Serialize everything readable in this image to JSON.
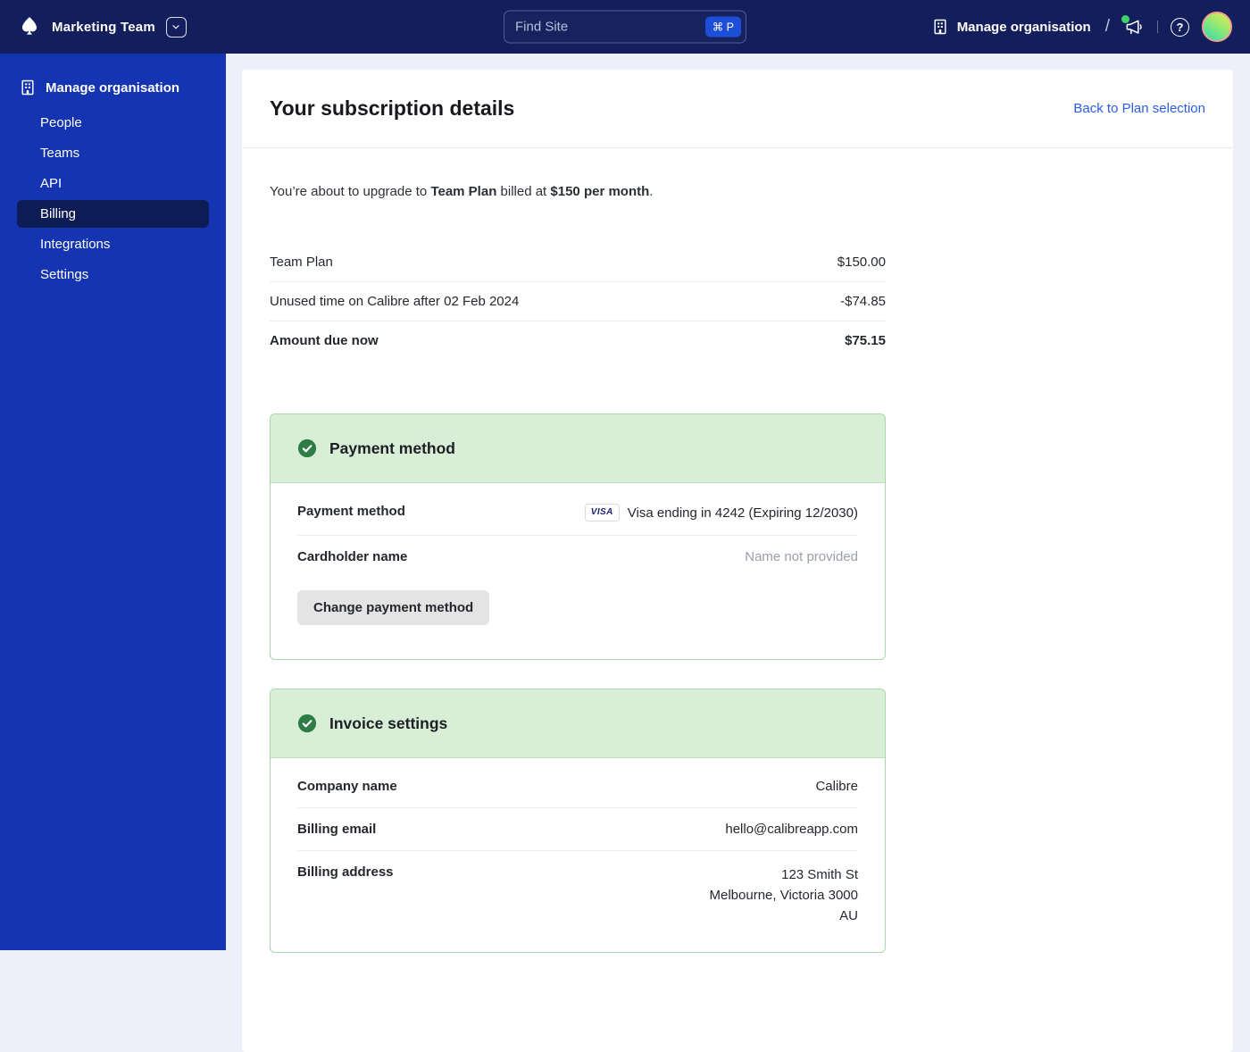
{
  "topbar": {
    "team_name": "Marketing Team",
    "search": {
      "placeholder": "Find Site",
      "shortcut": "⌘ P"
    },
    "manage_org_label": "Manage organisation",
    "slash": "/",
    "help_glyph": "?"
  },
  "sidebar": {
    "header": "Manage organisation",
    "items": [
      {
        "label": "People",
        "active": false
      },
      {
        "label": "Teams",
        "active": false
      },
      {
        "label": "API",
        "active": false
      },
      {
        "label": "Billing",
        "active": true
      },
      {
        "label": "Integrations",
        "active": false
      },
      {
        "label": "Settings",
        "active": false
      }
    ]
  },
  "main": {
    "title": "Your subscription details",
    "back_link": "Back to Plan selection",
    "upgrade_note": {
      "prefix": "You’re about to upgrade to ",
      "plan": "Team Plan",
      "middle": " billed at ",
      "price": "$150 per month",
      "suffix": "."
    },
    "summary_rows": [
      {
        "label": "Team Plan",
        "value": "$150.00"
      },
      {
        "label": "Unused time on Calibre after 02 Feb 2024",
        "value": "-$74.85"
      },
      {
        "label": "Amount due now",
        "value": "$75.15"
      }
    ],
    "payment_card": {
      "title": "Payment method",
      "visa_badge": "VISA",
      "rows": [
        {
          "label": "Payment method",
          "value": "Visa ending in 4242 (Expiring 12/2030)"
        },
        {
          "label": "Cardholder name",
          "value": "Name not provided"
        }
      ],
      "button": "Change payment method"
    },
    "invoice_card": {
      "title": "Invoice settings",
      "rows": [
        {
          "label": "Company name",
          "value": "Calibre"
        },
        {
          "label": "Billing email",
          "value": "hello@calibreapp.com"
        }
      ],
      "address_row": {
        "label": "Billing address",
        "lines": [
          "123 Smith St",
          "Melbourne, Victoria 3000",
          "AU"
        ]
      }
    }
  },
  "colors": {
    "topbar_bg": "#131f5c",
    "sidebar_bg": "#1434b2",
    "sidebar_active_bg": "#0d1c55",
    "content_bg": "#edf0fa",
    "badge_blue": "#1d4ed8",
    "link_blue": "#2b5de8",
    "green_header_bg": "#d9eed6",
    "green_border": "#a9d6ab",
    "green_check": "#2e7d46",
    "notification_green": "#3fd468",
    "avatar_ring": "#f79e8e",
    "muted_text": "#9aa0a8",
    "visa_blue": "#1a1f71"
  }
}
